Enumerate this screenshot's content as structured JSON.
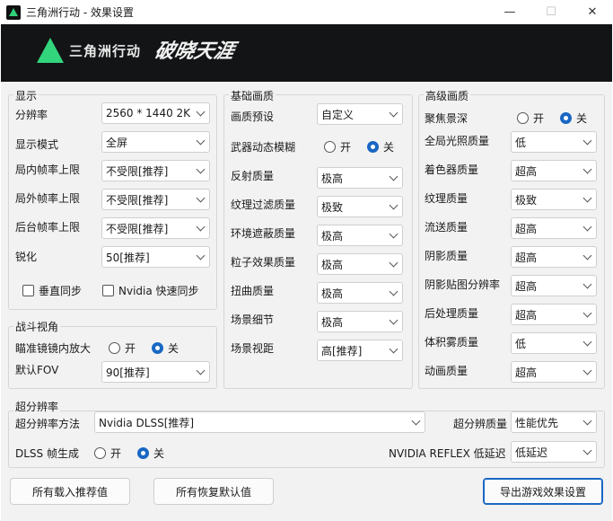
{
  "window": {
    "title": "三角洲行动 - 效果设置",
    "min_glyph": "—",
    "max_glyph": "☐",
    "close_glyph": "✕"
  },
  "banner": {
    "logo_text": "三角洲行动",
    "calligraphy_text": "破晓天涯"
  },
  "display": {
    "title": "显示",
    "resolution": {
      "label": "分辨率",
      "value": "2560 * 1440 2K"
    },
    "display_mode": {
      "label": "显示模式",
      "value": "全屏"
    },
    "fps_in_match": {
      "label": "局内帧率上限",
      "value": "不受限[推荐]"
    },
    "fps_out_match": {
      "label": "局外帧率上限",
      "value": "不受限[推荐]"
    },
    "fps_background": {
      "label": "后台帧率上限",
      "value": "不受限[推荐]"
    },
    "sharpen": {
      "label": "锐化",
      "value": "50[推荐]"
    },
    "vsync": {
      "label": "垂直同步",
      "checked": false
    },
    "nvidia_fastsync": {
      "label": "Nvidia 快速同步",
      "checked": false
    }
  },
  "combat_view": {
    "title": "战斗视角",
    "scope_zoom": {
      "label": "瞄准镜镜内放大",
      "on": "开",
      "off": "关",
      "selected": "关"
    },
    "default_fov": {
      "label": "默认FOV",
      "value": "90[推荐]"
    }
  },
  "basic_quality": {
    "title": "基础画质",
    "preset": {
      "label": "画质预设",
      "value": "自定义"
    },
    "weapon_blur": {
      "label": "武器动态模糊",
      "on": "开",
      "off": "关",
      "selected": "关"
    },
    "reflection": {
      "label": "反射质量",
      "value": "极高"
    },
    "texture_filter": {
      "label": "纹理过滤质量",
      "value": "极致"
    },
    "ambient_occlusion": {
      "label": "环境遮蔽质量",
      "value": "极高"
    },
    "particle": {
      "label": "粒子效果质量",
      "value": "极高"
    },
    "distortion": {
      "label": "扭曲质量",
      "value": "极高"
    },
    "scene_detail": {
      "label": "场景细节",
      "value": "极高"
    },
    "view_distance": {
      "label": "场景视距",
      "value": "高[推荐]"
    }
  },
  "advanced_quality": {
    "title": "高级画质",
    "depth_of_field": {
      "label": "聚焦景深",
      "on": "开",
      "off": "关",
      "selected": "关"
    },
    "global_illumination": {
      "label": "全局光照质量",
      "value": "低"
    },
    "shader": {
      "label": "着色器质量",
      "value": "超高"
    },
    "texture": {
      "label": "纹理质量",
      "value": "极致"
    },
    "streaming": {
      "label": "流送质量",
      "value": "超高"
    },
    "shadow": {
      "label": "阴影质量",
      "value": "超高"
    },
    "shadow_map_res": {
      "label": "阴影贴图分辨率",
      "value": "超高"
    },
    "post_process": {
      "label": "后处理质量",
      "value": "超高"
    },
    "volumetric_fog": {
      "label": "体积雾质量",
      "value": "低"
    },
    "animation": {
      "label": "动画质量",
      "value": "超高"
    }
  },
  "super_resolution": {
    "title": "超分辨率",
    "method": {
      "label": "超分辨率方法",
      "value": "Nvidia DLSS[推荐]"
    },
    "quality": {
      "label": "超分辨质量",
      "value": "性能优先"
    },
    "dlss_frame_gen": {
      "label": "DLSS 帧生成",
      "on": "开",
      "off": "关",
      "selected": "关"
    },
    "reflex": {
      "label": "NVIDIA REFLEX 低延迟",
      "value": "低延迟"
    }
  },
  "buttons": {
    "load_recommended": "所有载入推荐值",
    "restore_defaults": "所有恢复默认值",
    "export_settings": "导出游戏效果设置"
  },
  "colors": {
    "accent": "#1967c4",
    "brand_green": "#32d57c",
    "banner_bg": "#121416",
    "panel_bg": "#f2f2f2"
  }
}
